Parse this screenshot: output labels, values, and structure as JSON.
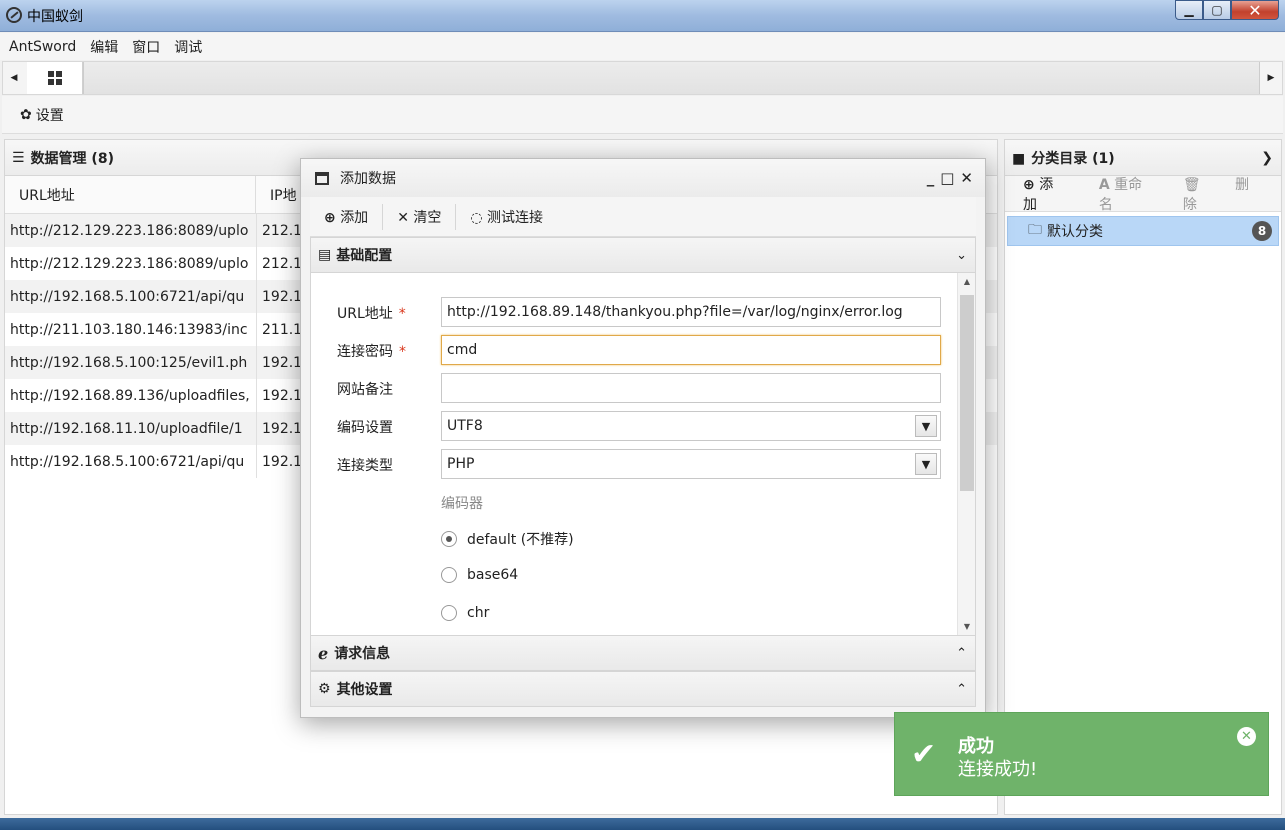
{
  "window": {
    "title": "中国蚁剑"
  },
  "menu": [
    "AntSword",
    "编辑",
    "窗口",
    "调试"
  ],
  "toolbar": {
    "settings_label": "设置"
  },
  "data_panel": {
    "title": "数据管理 (8)",
    "columns": [
      "URL地址",
      "IP地"
    ],
    "rows": [
      {
        "url": "http://212.129.223.186:8089/uplo",
        "ip": "212.1"
      },
      {
        "url": "http://212.129.223.186:8089/uplo",
        "ip": "212.1"
      },
      {
        "url": "http://192.168.5.100:6721/api/qu",
        "ip": "192.1"
      },
      {
        "url": "http://211.103.180.146:13983/inc",
        "ip": "211.1"
      },
      {
        "url": "http://192.168.5.100:125/evil1.ph",
        "ip": "192.1"
      },
      {
        "url": "http://192.168.89.136/uploadfiles,",
        "ip": "192.1"
      },
      {
        "url": "http://192.168.11.10/uploadfile/1",
        "ip": "192.1"
      },
      {
        "url": "http://192.168.5.100:6721/api/qu",
        "ip": "192.1"
      }
    ]
  },
  "category_panel": {
    "title": "分类目录 (1)",
    "add_label": "添加",
    "rename_label": "重命名",
    "delete_label": "删除",
    "items": [
      {
        "label": "默认分类",
        "count": "8"
      }
    ]
  },
  "dialog": {
    "title": "添加数据",
    "toolbar": {
      "add": "添加",
      "clear": "清空",
      "test": "测试连接"
    },
    "section_basic": "基础配置",
    "fields": {
      "url": {
        "label": "URL地址",
        "value": "http://192.168.89.148/thankyou.php?file=/var/log/nginx/error.log"
      },
      "password": {
        "label": "连接密码",
        "value": "cmd"
      },
      "note": {
        "label": "网站备注",
        "value": ""
      },
      "encoding": {
        "label": "编码设置",
        "value": "UTF8"
      },
      "type": {
        "label": "连接类型",
        "value": "PHP"
      }
    },
    "required_mark": "*",
    "encoder_label": "编码器",
    "encoders": [
      {
        "label": "default (不推荐)",
        "selected": true
      },
      {
        "label": "base64",
        "selected": false
      },
      {
        "label": "chr",
        "selected": false
      }
    ],
    "section_request": "请求信息",
    "section_other": "其他设置"
  },
  "toast": {
    "title": "成功",
    "message": "连接成功!"
  },
  "colors": {
    "toast_bg": "#6fb36a",
    "selected_bg": "#b9d7f7",
    "required": "#d9361b"
  }
}
